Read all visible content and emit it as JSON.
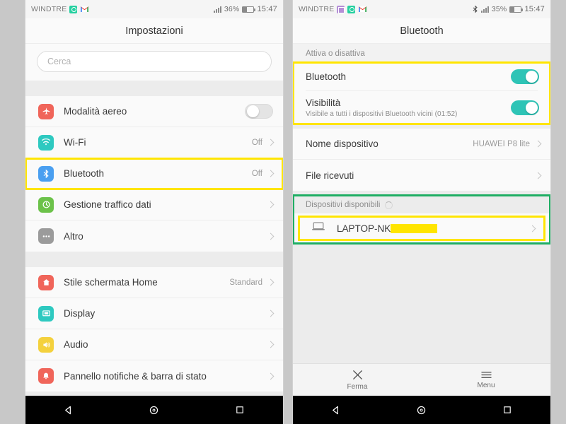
{
  "left_phone": {
    "status_bar": {
      "carrier": "WINDTRE",
      "battery_percent": "36%",
      "clock": "15:47",
      "icons": [
        "whatsapp-icon",
        "gmail-icon",
        "signal-icon",
        "battery-icon"
      ]
    },
    "title": "Impostazioni",
    "search": {
      "placeholder": "Cerca"
    },
    "groups": [
      {
        "rows": [
          {
            "label": "Modalità aereo",
            "icon": "airplane-mode-icon",
            "icon_color": "#f0655a",
            "control": "toggle",
            "toggle_state": "off"
          },
          {
            "label": "Wi-Fi",
            "icon": "wifi-icon",
            "icon_color": "#2ec9c0",
            "value": "Off",
            "control": "chevron"
          },
          {
            "label": "Bluetooth",
            "icon": "bluetooth-icon",
            "icon_color": "#4a9ff0",
            "value": "Off",
            "control": "chevron",
            "highlight": "yellow"
          },
          {
            "label": "Gestione traffico dati",
            "icon": "data-usage-icon",
            "icon_color": "#6cc24a",
            "value": "",
            "control": "chevron"
          },
          {
            "label": "Altro",
            "icon": "more-icon",
            "icon_color": "#9b9b9b",
            "value": "",
            "control": "chevron"
          }
        ]
      },
      {
        "rows": [
          {
            "label": "Stile schermata Home",
            "icon": "home-style-icon",
            "icon_color": "#f0655a",
            "value": "Standard",
            "control": "chevron"
          },
          {
            "label": "Display",
            "icon": "display-icon",
            "icon_color": "#2ec9c0",
            "value": "",
            "control": "chevron"
          },
          {
            "label": "Audio",
            "icon": "audio-icon",
            "icon_color": "#f4d13d",
            "value": "",
            "control": "chevron"
          },
          {
            "label": "Pannello notifiche & barra di stato",
            "icon": "notification-panel-icon",
            "icon_color": "#f0655a",
            "value": "",
            "control": "chevron"
          }
        ]
      }
    ]
  },
  "right_phone": {
    "status_bar": {
      "carrier": "WINDTRE",
      "battery_percent": "35%",
      "clock": "15:47",
      "icons": [
        "calendar-icon",
        "whatsapp-icon",
        "gmail-icon",
        "bluetooth-status-icon",
        "signal-icon",
        "battery-icon"
      ]
    },
    "title": "Bluetooth",
    "section_activate": "Attiva o disattiva",
    "toggles": [
      {
        "label": "Bluetooth",
        "sub": "",
        "state": "on"
      },
      {
        "label": "Visibilità",
        "sub": "Visibile a tutti i dispositivi Bluetooth vicini (01:52)",
        "state": "on"
      }
    ],
    "rows": [
      {
        "label": "Nome dispositivo",
        "value": "HUAWEI P8 lite",
        "control": "chevron"
      },
      {
        "label": "File ricevuti",
        "value": "",
        "control": "chevron"
      }
    ],
    "available_section": {
      "header": "Dispositivi disponibili",
      "scanning": true,
      "devices": [
        {
          "name": "LAPTOP-NK",
          "redacted": true,
          "icon": "laptop-icon"
        }
      ]
    },
    "action_bar": [
      {
        "label": "Ferma",
        "icon": "close-x-icon"
      },
      {
        "label": "Menu",
        "icon": "hamburger-menu-icon"
      }
    ]
  },
  "nav_bar": {
    "back": "back-triangle-icon",
    "home": "home-circle-icon",
    "recents": "recents-square-icon"
  },
  "colors": {
    "accent_teal": "#2ec4b6",
    "highlight_yellow": "#ffe500",
    "highlight_green": "#1fae63"
  }
}
